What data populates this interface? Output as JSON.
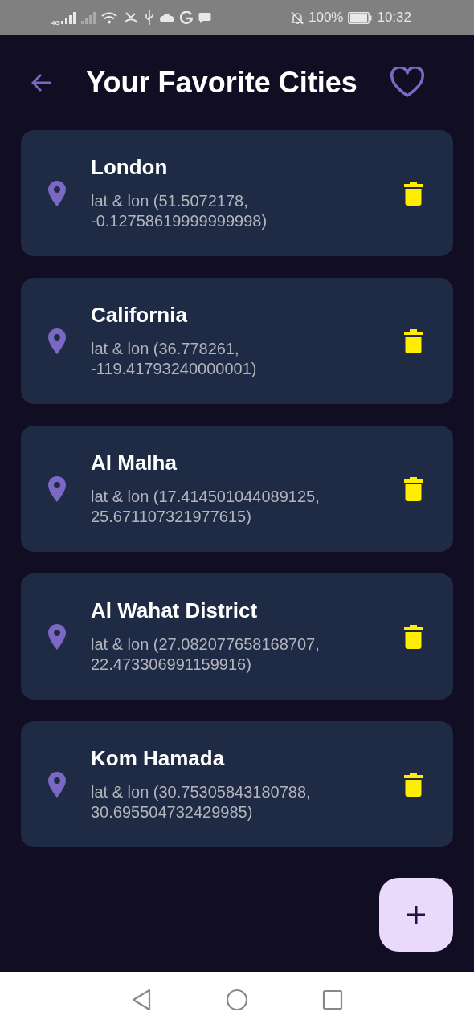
{
  "status_bar": {
    "network": "4G",
    "battery": "100%",
    "time": "10:32"
  },
  "header": {
    "title": "Your Favorite Cities"
  },
  "cities": [
    {
      "name": "London",
      "coords": "lat & lon (51.5072178, -0.12758619999999998)"
    },
    {
      "name": "California",
      "coords": "lat & lon (36.778261, -119.41793240000001)"
    },
    {
      "name": "Al Malha",
      "coords": "lat & lon (17.414501044089125, 25.671107321977615)"
    },
    {
      "name": "Al Wahat District",
      "coords": "lat & lon (27.082077658168707, 22.473306991159916)"
    },
    {
      "name": "Kom Hamada",
      "coords": "lat & lon (30.75305843180788, 30.695504732429985)"
    }
  ]
}
